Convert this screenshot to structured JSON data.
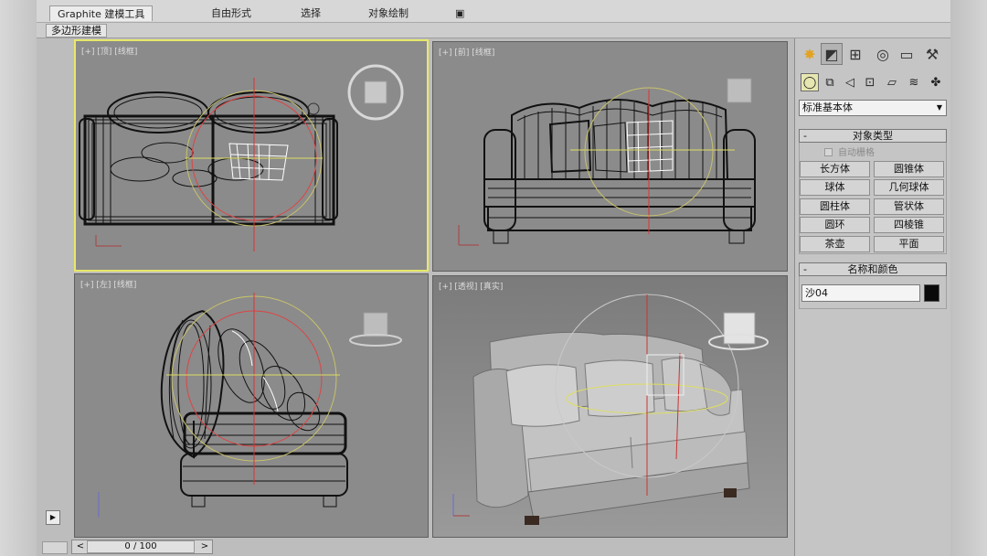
{
  "ribbon": {
    "tabs": [
      "Graphite 建模工具",
      "自由形式",
      "选择",
      "对象绘制",
      "▣"
    ],
    "active_tab": "Graphite 建模工具",
    "sub_tab": "多边形建模"
  },
  "viewports": [
    {
      "label": "[+] [顶] [线框]",
      "view": "top",
      "active": true
    },
    {
      "label": "[+] [前] [线框]",
      "view": "front",
      "active": false
    },
    {
      "label": "[+] [左] [线框]",
      "view": "left",
      "active": false
    },
    {
      "label": "[+] [透视] [真实]",
      "view": "perspective",
      "active": false
    }
  ],
  "command_panel": {
    "tab_icons": [
      "create-icon",
      "modify-icon",
      "hierarchy-icon",
      "motion-icon",
      "display-icon",
      "utilities-icon"
    ],
    "sub_icons": [
      "geometry-icon",
      "shapes-icon",
      "lights-icon",
      "cameras-icon",
      "helpers-icon",
      "spacewarps-icon",
      "systems-icon"
    ],
    "category_dropdown": "标准基本体",
    "object_type": {
      "title": "对象类型",
      "autogrid_label": "自动栅格",
      "buttons": [
        "长方体",
        "圆锥体",
        "球体",
        "几何球体",
        "圆柱体",
        "管状体",
        "圆环",
        "四棱锥",
        "茶壶",
        "平面"
      ]
    },
    "name_color": {
      "title": "名称和颜色",
      "name_value": "沙04",
      "color": "#0a0a0a"
    }
  },
  "timeline": {
    "counter": "0 / 100",
    "prev": "<",
    "next": ">"
  },
  "colors": {
    "viewport_bg": "#8b8b8b",
    "active_border": "#e8e86a",
    "panel_bg": "#c5c5c5"
  }
}
